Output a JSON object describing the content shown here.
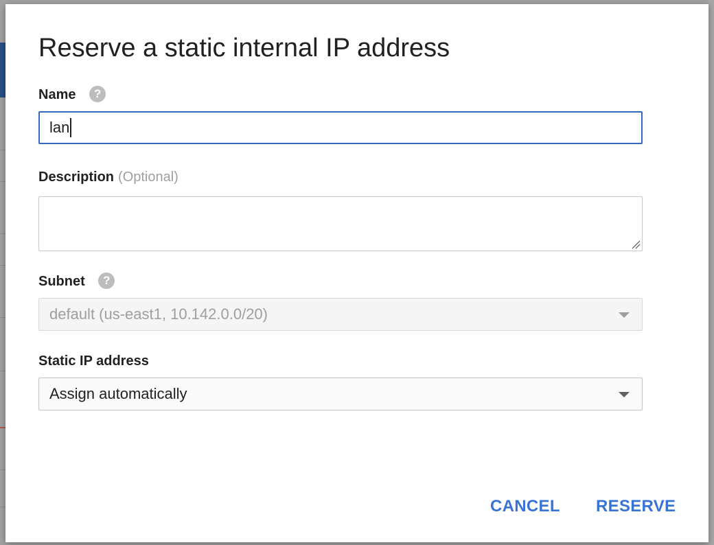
{
  "dialog": {
    "title": "Reserve a static internal IP address",
    "name_label": "Name",
    "name_value": "lan",
    "description_label": "Description",
    "description_optional": "(Optional)",
    "description_value": "",
    "subnet_label": "Subnet",
    "subnet_value": "default (us-east1, 10.142.0.0/20)",
    "static_ip_label": "Static IP address",
    "static_ip_value": "Assign automatically",
    "help_glyph": "?",
    "cancel_label": "CANCEL",
    "reserve_label": "RESERVE"
  },
  "colors": {
    "accent": "#3a73d6",
    "focus_border": "#3467c4"
  },
  "icons": {
    "help": "help-icon",
    "dropdown": "chevron-down-icon",
    "resize": "resize-grip-icon"
  }
}
